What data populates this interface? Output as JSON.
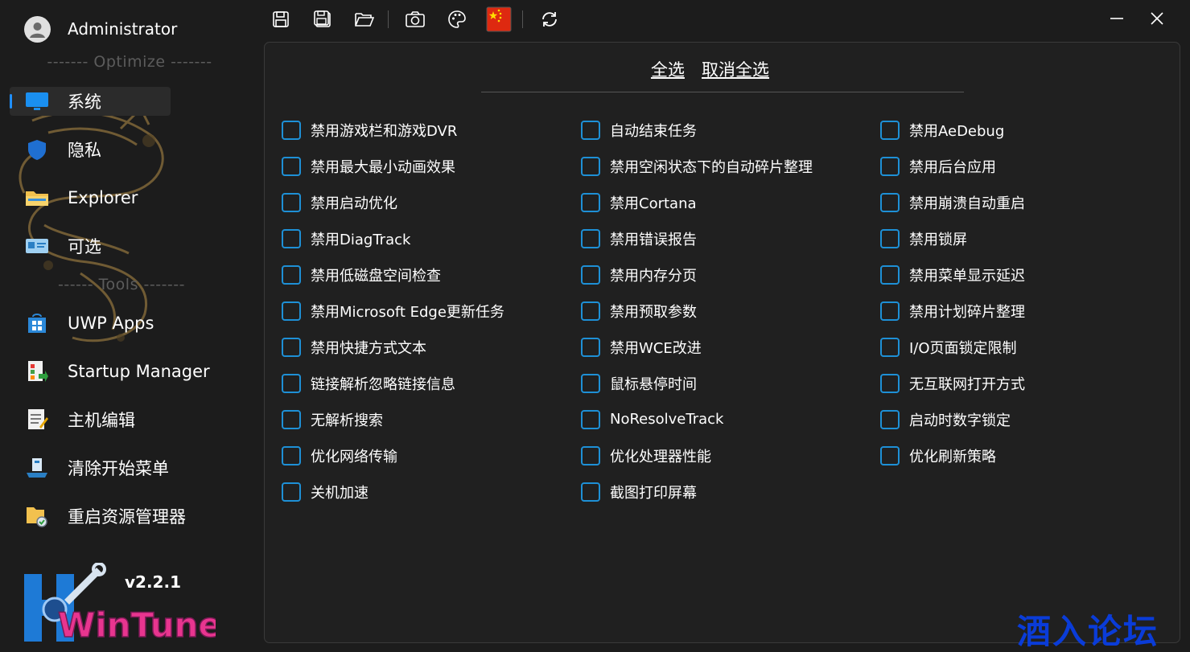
{
  "user": {
    "name": "Administrator"
  },
  "sidebar": {
    "optimize_divider": "------- Optimize -------",
    "tools_divider": "------ Tools -------",
    "nav": [
      {
        "label": "系统",
        "icon": "monitor-icon"
      },
      {
        "label": "隐私",
        "icon": "shield-icon"
      },
      {
        "label": "Explorer",
        "icon": "folder-icon"
      },
      {
        "label": "可选",
        "icon": "control-panel-icon"
      },
      {
        "label": "UWP Apps",
        "icon": "windows-store-icon"
      },
      {
        "label": "Startup Manager",
        "icon": "startup-manager-icon"
      },
      {
        "label": "主机编辑",
        "icon": "hosts-edit-icon"
      },
      {
        "label": "清除开始菜单",
        "icon": "clean-startmenu-icon"
      },
      {
        "label": "重启资源管理器",
        "icon": "restart-explorer-icon"
      }
    ],
    "version": "v2.2.1",
    "brand": "WinTune"
  },
  "toolbar": {
    "buttons": [
      "save-icon",
      "save-as-icon",
      "open-folder-icon",
      "camera-icon",
      "palette-icon",
      "china-flag-icon",
      "refresh-icon"
    ]
  },
  "panel": {
    "select_all": "全选",
    "deselect_all": "取消全选",
    "columns": [
      [
        "禁用游戏栏和游戏DVR",
        "禁用最大最小动画效果",
        "禁用启动优化",
        "禁用DiagTrack",
        "禁用低磁盘空间检查",
        "禁用Microsoft Edge更新任务",
        "禁用快捷方式文本",
        "链接解析忽略链接信息",
        "无解析搜索",
        "优化网络传输",
        "关机加速"
      ],
      [
        "自动结束任务",
        "禁用空闲状态下的自动碎片整理",
        "禁用Cortana",
        "禁用错误报告",
        "禁用内存分页",
        "禁用预取参数",
        "禁用WCE改进",
        "鼠标悬停时间",
        "NoResolveTrack",
        "优化处理器性能",
        "截图打印屏幕"
      ],
      [
        "禁用AeDebug",
        "禁用后台应用",
        "禁用崩溃自动重启",
        "禁用锁屏",
        "禁用菜单显示延迟",
        "禁用计划碎片整理",
        "I/O页面锁定限制",
        "无互联网打开方式",
        "启动时数字锁定",
        "优化刷新策略"
      ]
    ]
  },
  "watermark": "酒入论坛",
  "colors": {
    "accent": "#1e90d6",
    "background": "#1c1c1c",
    "panel": "#202020",
    "watermark": "#0a3cd8"
  }
}
